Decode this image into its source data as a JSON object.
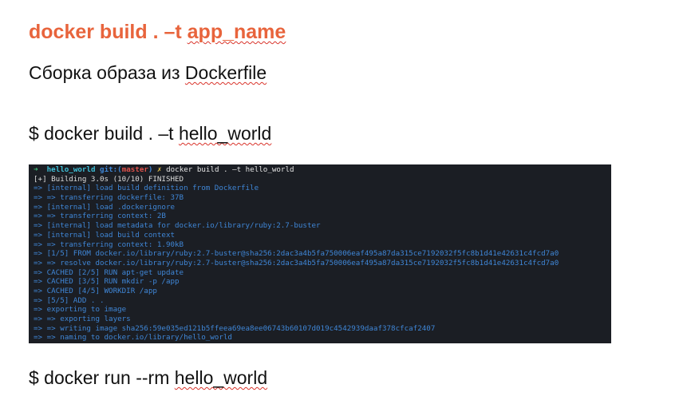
{
  "slide": {
    "title": "docker build . –t app_name",
    "subtitle": "Сборка образа из Dockerfile",
    "build_command": "$ docker build . –t hello_world",
    "run_command": "$ docker run --rm hello_world"
  },
  "terminal": {
    "prompt": {
      "arrow": "➜",
      "directory": "hello_world",
      "git_label": "git:(",
      "branch": "master",
      "git_close": ")",
      "dirty_marker": "✗",
      "command": "docker build . –t hello_world"
    },
    "status_line": "[+] Building 3.0s (10/10) FINISHED",
    "lines": [
      "=> [internal] load build definition from Dockerfile",
      "=> => transferring dockerfile: 37B",
      "=> [internal] load .dockerignore",
      "=> => transferring context: 2B",
      "=> [internal] load metadata for docker.io/library/ruby:2.7-buster",
      "=> [internal] load build context",
      "=> => transferring context: 1.90kB",
      "=> [1/5] FROM docker.io/library/ruby:2.7-buster@sha256:2dac3a4b5fa750006eaf495a87da315ce7192032f5fc8b1d41e42631c4fcd7a0",
      "=> => resolve docker.io/library/ruby:2.7-buster@sha256:2dac3a4b5fa750006eaf495a87da315ce7192032f5fc8b1d41e42631c4fcd7a0",
      "=> CACHED [2/5] RUN apt-get update",
      "=> CACHED [3/5] RUN mkdir -p /app",
      "=> CACHED [4/5] WORKDIR /app",
      "=> [5/5] ADD . .",
      "=> exporting to image",
      "=> => exporting layers",
      "=> => writing image sha256:59e035ed121b5ffeea69ea8ee06743b60107d019c4542939daaf378cfcaf2407",
      "=> => naming to docker.io/library/hello_world"
    ]
  }
}
